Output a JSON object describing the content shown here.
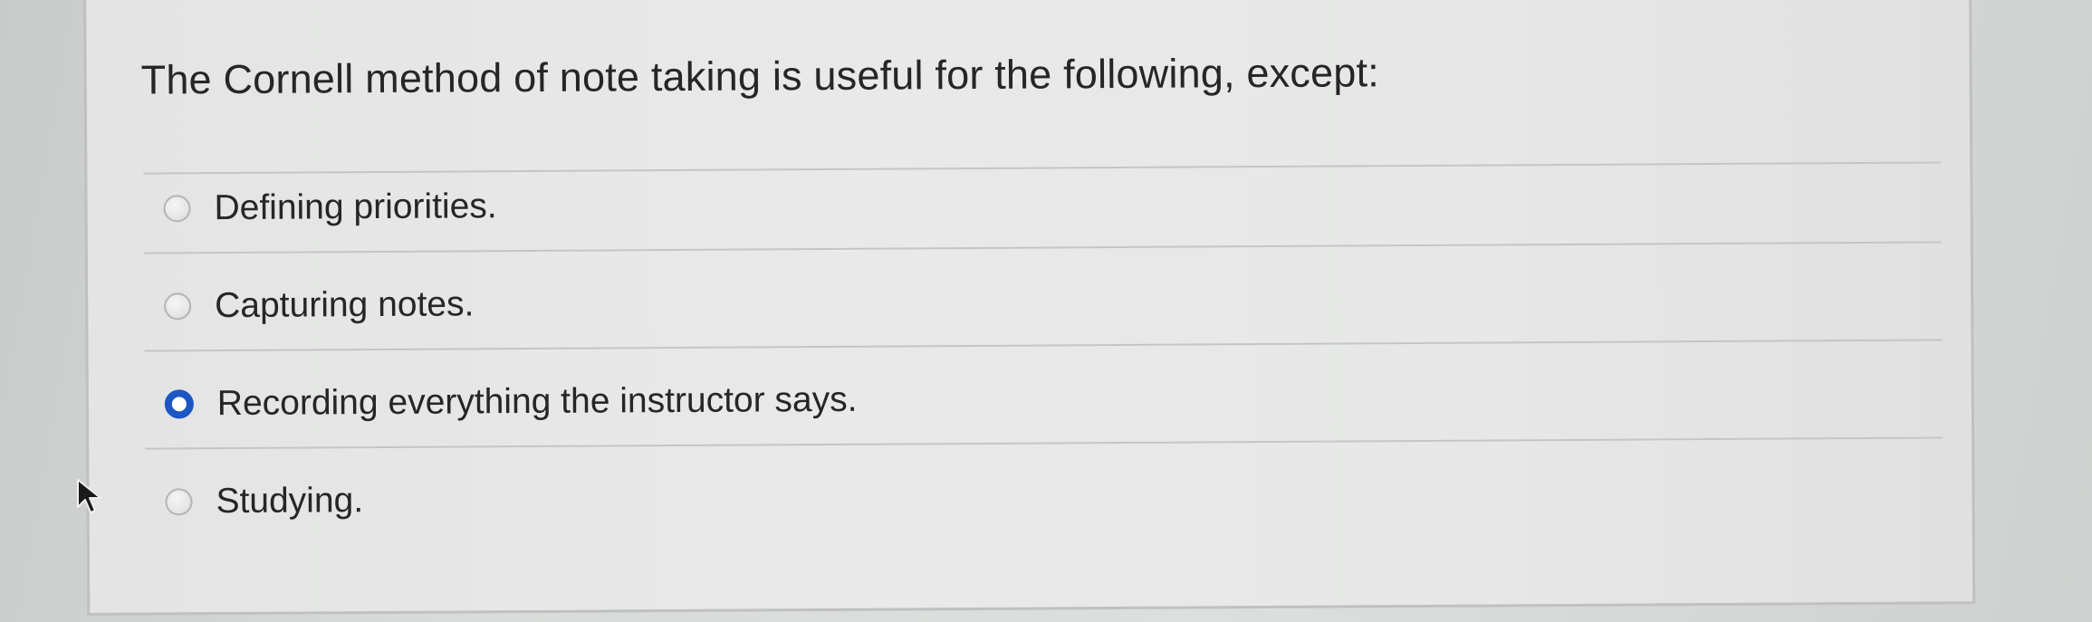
{
  "question": {
    "text": "The Cornell method of note taking is useful for the following, except:"
  },
  "answers": [
    {
      "label": "Defining priorities.",
      "selected": false
    },
    {
      "label": "Capturing notes.",
      "selected": false
    },
    {
      "label": "Recording everything the instructor says.",
      "selected": true
    },
    {
      "label": "Studying.",
      "selected": false
    }
  ],
  "colors": {
    "selected_radio": "#1c56c2",
    "text": "#262626",
    "card_background": "#e6e7e6"
  },
  "icons": {
    "cursor": "mouse-pointer-arrow",
    "radio": "radio-circle"
  }
}
